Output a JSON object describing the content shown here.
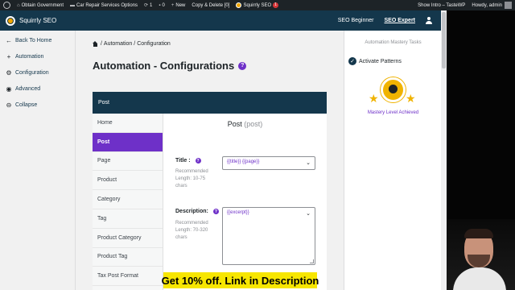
{
  "admin_bar": {
    "site_name": "Obtain Government",
    "options": "Car Repair Services Options",
    "updates": "1",
    "comments": "0",
    "new_label": "New",
    "copy_delete": "Copy & Delete [0]",
    "squirrly": "Squirrly SEO",
    "squirrly_badge": "1",
    "show_intro": "Show Intro – TasteWP",
    "howdy": "Howdy, admin"
  },
  "header": {
    "brand": "Squirrly SEO",
    "nav": [
      "SEO Beginner",
      "SEO Expert"
    ]
  },
  "left_nav": [
    {
      "label": "Back To Home",
      "icon": "back-arrow-icon"
    },
    {
      "label": "Automation",
      "icon": "plus-icon"
    },
    {
      "label": "Configuration",
      "icon": "gear-icon"
    },
    {
      "label": "Advanced",
      "icon": "advanced-icon"
    },
    {
      "label": "Collapse",
      "icon": "collapse-icon"
    }
  ],
  "breadcrumb": {
    "separator": "/",
    "items": [
      "Automation",
      "Configuration"
    ]
  },
  "page_title": "Automation - Configurations",
  "panel": {
    "header": "Post",
    "tabs": [
      "Home",
      "Post",
      "Page",
      "Product",
      "Category",
      "Tag",
      "Product Category",
      "Product Tag",
      "Tax Post Format"
    ],
    "active_tab": "Post",
    "form_title": "Post",
    "form_subtitle": "(post)",
    "title_field": {
      "label": "Title :",
      "hint": "Recommended Length: 10-75 chars",
      "value": "{{title}} {{page}}"
    },
    "description_field": {
      "label": "Description:",
      "hint": "Recommended Length: 70-320 chars",
      "value": "{{excerpt}}"
    }
  },
  "right_column": {
    "title": "Automation Mastery Tasks",
    "task": "Activate Patterns",
    "achievement": "Mastery Level Achieved"
  },
  "promo": "Get 10% off. Link in Description",
  "colors": {
    "admin_bar": "#1d2327",
    "header": "#14374c",
    "accent_purple": "#6e30c8",
    "promo_yellow": "#f7e600",
    "badge_gold": "#f0b300"
  }
}
